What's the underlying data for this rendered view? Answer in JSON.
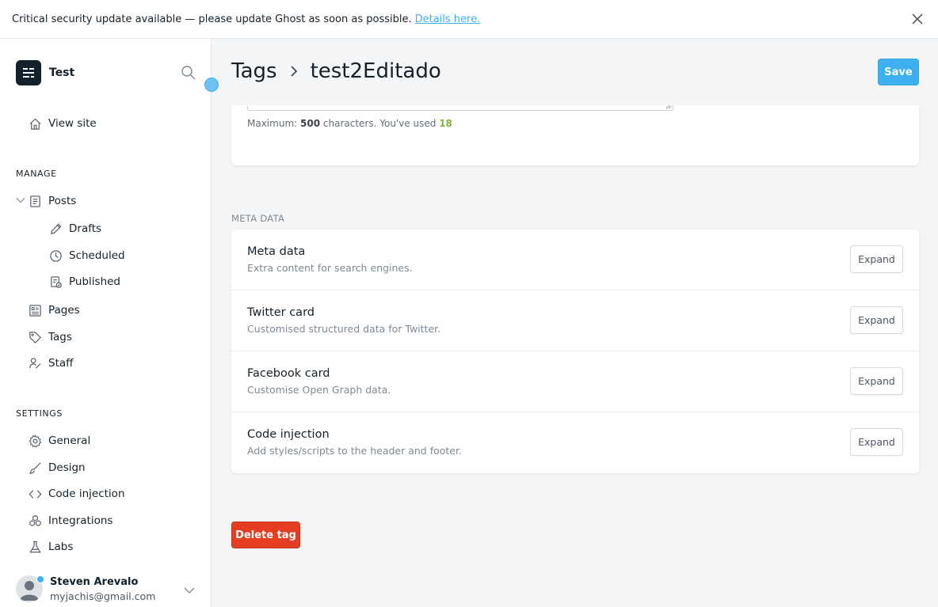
{
  "banner": {
    "message": "Critical security update available — please update Ghost as soon as possible.",
    "link_text": "Details here."
  },
  "sidebar": {
    "site_name": "Test",
    "view_site": "View site",
    "manage_label": "MANAGE",
    "posts": "Posts",
    "drafts": "Drafts",
    "scheduled": "Scheduled",
    "published": "Published",
    "pages": "Pages",
    "tags": "Tags",
    "staff": "Staff",
    "settings_label": "SETTINGS",
    "general": "General",
    "design": "Design",
    "code_injection": "Code injection",
    "integrations": "Integrations",
    "labs": "Labs",
    "user": {
      "name": "Steven Arevalo",
      "email": "myjachis@gmail.com"
    }
  },
  "header": {
    "crumb_root": "Tags",
    "crumb_current": "test2Editado",
    "save_label": "Save"
  },
  "description": {
    "max_prefix": "Maximum:",
    "max_value": "500",
    "used_prefix": "characters. You've used",
    "used_value": "18"
  },
  "meta": {
    "section_label": "META DATA",
    "rows": [
      {
        "title": "Meta data",
        "desc": "Extra content for search engines.",
        "button": "Expand"
      },
      {
        "title": "Twitter card",
        "desc": "Customised structured data for Twitter.",
        "button": "Expand"
      },
      {
        "title": "Facebook card",
        "desc": "Customise Open Graph data.",
        "button": "Expand"
      },
      {
        "title": "Code injection",
        "desc": "Add styles/scripts to the header and footer.",
        "button": "Expand"
      }
    ]
  },
  "delete_label": "Delete tag",
  "colors": {
    "accent": "#3eb0ef",
    "danger": "#e33d22",
    "count_green": "#7eb443"
  }
}
